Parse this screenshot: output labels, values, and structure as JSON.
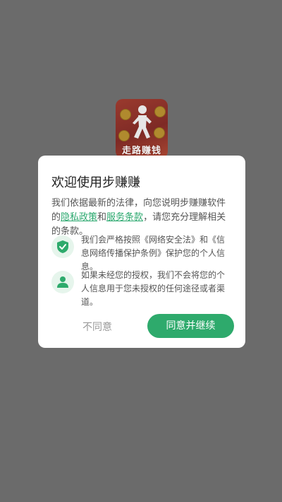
{
  "app": {
    "icon_label": "走路赚钱",
    "icon_name": "walking-man-icon"
  },
  "dialog": {
    "title": "欢迎使用步赚赚",
    "intro_before": "我们依据最新的法律，向您说明步赚赚软件的",
    "privacy_link": "隐私政策",
    "and_text": "和",
    "terms_link": "服务条款",
    "intro_after": "，请您充分理解相关的条款。",
    "points": [
      {
        "icon": "shield-check-icon",
        "text": "我们会严格按照《网络安全法》和《信息网络传播保护条例》保护您的个人信息。"
      },
      {
        "icon": "user-icon",
        "text": "如果未经您的授权，我们不会将您的个人信息用于您未授权的任何途径或者渠道。"
      }
    ],
    "disagree_label": "不同意",
    "agree_label": "同意并继续"
  },
  "colors": {
    "overlay": "#6b6b6b",
    "accent": "#2eaa6c",
    "link": "#2aa86e",
    "icon_bg": "#e6f5ec"
  }
}
